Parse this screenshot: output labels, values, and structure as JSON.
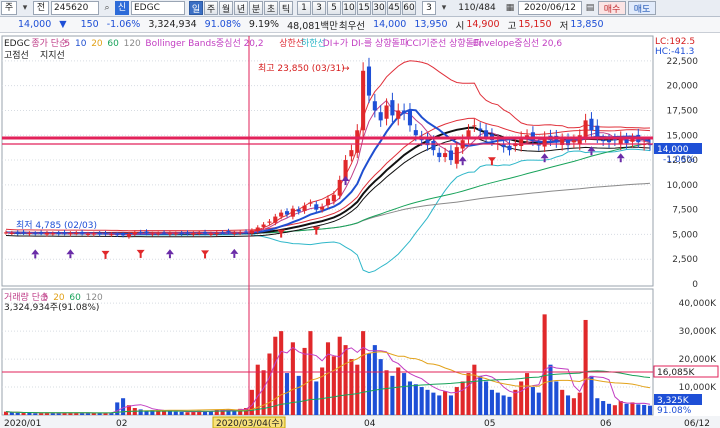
{
  "toolbar": {
    "stock_code_type": "주",
    "prev_label": "전",
    "code": "245620",
    "search_icon": "search-icon",
    "market": "신",
    "name": "EDGC",
    "periods": [
      "일",
      "주",
      "월",
      "년",
      "분",
      "초",
      "틱"
    ],
    "minute_options": [
      "1",
      "3",
      "5",
      "10",
      "15",
      "30",
      "45",
      "60"
    ],
    "selected_period": "일",
    "interval": "3",
    "range": "110/484",
    "date": "2020/06/12",
    "buy_label": "매수",
    "sell_label": "매도"
  },
  "quote": {
    "price": "14,000",
    "change": "150",
    "change_pct": "-1.06%",
    "volume": "3,324,934",
    "vol_ratio": "91.08%",
    "turnover": "9.19%",
    "amount": "48,081백만",
    "min_label": "최우선",
    "best_bid": "14,000",
    "best_ask": "13,950",
    "open_label": "시",
    "open": "14,900",
    "high_label": "고",
    "high": "15,150",
    "low_label": "저",
    "low": "13,850"
  },
  "price_panel": {
    "legend": [
      {
        "text": "EDGC",
        "color": "#222222"
      },
      {
        "text": "종가 단순",
        "color": "#c0408a"
      },
      {
        "text": "5",
        "color": "#c0408a"
      },
      {
        "text": "10",
        "color": "#1f4fd0"
      },
      {
        "text": "20",
        "color": "#e2a21a"
      },
      {
        "text": "60",
        "color": "#18a35a"
      },
      {
        "text": "120",
        "color": "#8a8a8a"
      },
      {
        "text": "Bollinger Bands중심선 20,2",
        "color": "#c23ec2"
      },
      {
        "text": "상한선",
        "color": "#e0303a"
      },
      {
        "text": "하한선",
        "color": "#2fb7c9"
      },
      {
        "text": "DI+가 DI-를 상향돌파",
        "color": "#c23ec2"
      },
      {
        "text": "CCI기준선 상향돌파",
        "color": "#c23ec2"
      },
      {
        "text": "Envelope중심선 20,6",
        "color": "#c23ec2"
      }
    ],
    "sub_legend": [
      "고점선",
      "지지선"
    ],
    "high_annotation": "최고 23,850 (03/31)",
    "low_annotation": "최저 4,785 (02/03)",
    "right_top_labels": [
      "LC:192.5",
      "HC:-41.3"
    ],
    "current_price_box": "14,000",
    "current_change_box": "-1.06%",
    "yaxis": [
      "22,500",
      "20,000",
      "17,500",
      "15,000",
      "12,500",
      "10,000",
      "7,500",
      "5,000",
      "2,500",
      "0"
    ]
  },
  "volume_panel": {
    "legend": [
      {
        "text": "거래량 단순",
        "color": "#c0408a"
      },
      {
        "text": "5",
        "color": "#c0408a"
      },
      {
        "text": "20",
        "color": "#e2a21a"
      },
      {
        "text": "60",
        "color": "#18a35a"
      },
      {
        "text": "120",
        "color": "#8a8a8a"
      }
    ],
    "volume_text": "3,324,934주(91.08%)",
    "yaxis": [
      "40,000K",
      "30,000K",
      "20,000K",
      "10,000K"
    ],
    "ref_box": "16,085K",
    "cur_box": "3,325K",
    "cur_pct": "91.08%"
  },
  "xaxis": {
    "labels": [
      "2020/01",
      "02",
      "2020/03/04(수)",
      "04",
      "05",
      "06",
      "06/12"
    ]
  },
  "chart_data": {
    "type": "candlestick",
    "ylim": [
      0,
      24000
    ],
    "days": [
      "01/02",
      "01/03",
      "01/06",
      "01/07",
      "01/08",
      "01/09",
      "01/10",
      "01/13",
      "01/14",
      "01/15",
      "01/16",
      "01/17",
      "01/20",
      "01/21",
      "01/22",
      "01/23",
      "01/28",
      "01/29",
      "01/30",
      "01/31",
      "02/03",
      "02/04",
      "02/05",
      "02/06",
      "02/07",
      "02/10",
      "02/11",
      "02/12",
      "02/13",
      "02/14",
      "02/17",
      "02/18",
      "02/19",
      "02/20",
      "02/21",
      "02/24",
      "02/25",
      "02/26",
      "02/27",
      "02/28",
      "03/02",
      "03/03",
      "03/04",
      "03/05",
      "03/06",
      "03/09",
      "03/10",
      "03/11",
      "03/12",
      "03/13",
      "03/16",
      "03/17",
      "03/18",
      "03/19",
      "03/20",
      "03/23",
      "03/24",
      "03/25",
      "03/26",
      "03/27",
      "03/30",
      "03/31",
      "04/01",
      "04/02",
      "04/03",
      "04/06",
      "04/07",
      "04/08",
      "04/09",
      "04/10",
      "04/13",
      "04/14",
      "04/16",
      "04/17",
      "04/20",
      "04/21",
      "04/22",
      "04/23",
      "04/24",
      "04/27",
      "04/28",
      "04/29",
      "05/04",
      "05/06",
      "05/07",
      "05/08",
      "05/11",
      "05/12",
      "05/13",
      "05/14",
      "05/15",
      "05/18",
      "05/19",
      "05/20",
      "05/21",
      "05/22",
      "05/25",
      "05/26",
      "05/27",
      "05/28",
      "05/29",
      "06/01",
      "06/02",
      "06/03",
      "06/04",
      "06/05",
      "06/08",
      "06/09",
      "06/10",
      "06/11",
      "06/12"
    ],
    "close": [
      5200,
      5150,
      5100,
      5150,
      5120,
      5100,
      5130,
      5150,
      5100,
      5080,
      5100,
      5120,
      5150,
      5100,
      5050,
      5080,
      5000,
      5050,
      5020,
      4950,
      4900,
      5050,
      5200,
      5150,
      5100,
      5080,
      5100,
      5150,
      5120,
      5100,
      5050,
      5080,
      5120,
      5150,
      5100,
      5080,
      5150,
      5200,
      5180,
      5150,
      5200,
      5250,
      5400,
      5700,
      6000,
      6300,
      6800,
      7200,
      7000,
      7600,
      7300,
      7900,
      8200,
      7500,
      7800,
      8600,
      9000,
      10500,
      12500,
      13500,
      15500,
      21500,
      19000,
      17500,
      16500,
      18000,
      17000,
      17500,
      17200,
      16000,
      15000,
      14500,
      14000,
      13500,
      12800,
      13200,
      12500,
      13800,
      14500,
      15500,
      16000,
      15500,
      14800,
      14500,
      14200,
      13800,
      13500,
      14200,
      14800,
      15000,
      14500,
      14000,
      14800,
      14500,
      14300,
      14600,
      14000,
      14500,
      15000,
      16500,
      15500,
      14800,
      14500,
      14300,
      14500,
      14800,
      14200,
      14600,
      14300,
      14150,
      14000
    ],
    "volume_k": [
      1200,
      900,
      800,
      700,
      850,
      600,
      700,
      900,
      650,
      600,
      700,
      800,
      900,
      700,
      600,
      650,
      700,
      800,
      900,
      4500,
      6000,
      3500,
      2500,
      2000,
      1500,
      1800,
      1600,
      1400,
      1300,
      1200,
      1100,
      1000,
      1200,
      1500,
      1400,
      1300,
      1800,
      2000,
      1900,
      1700,
      2200,
      2500,
      9000,
      18000,
      16000,
      22000,
      28000,
      30000,
      15000,
      26000,
      14000,
      24000,
      30000,
      12000,
      17000,
      26000,
      21000,
      28000,
      25000,
      20000,
      18000,
      30000,
      22000,
      25000,
      20000,
      16000,
      14000,
      17000,
      15000,
      12000,
      11000,
      10000,
      9000,
      8000,
      7000,
      8500,
      7000,
      10000,
      12000,
      15000,
      18000,
      14000,
      12000,
      9000,
      8000,
      7000,
      6500,
      9000,
      12000,
      15000,
      10000,
      8000,
      36000,
      18000,
      12000,
      9000,
      7000,
      6000,
      8000,
      34000,
      14000,
      6000,
      5000,
      4000,
      3500,
      5000,
      4000,
      4500,
      3800,
      3600,
      3325
    ]
  }
}
